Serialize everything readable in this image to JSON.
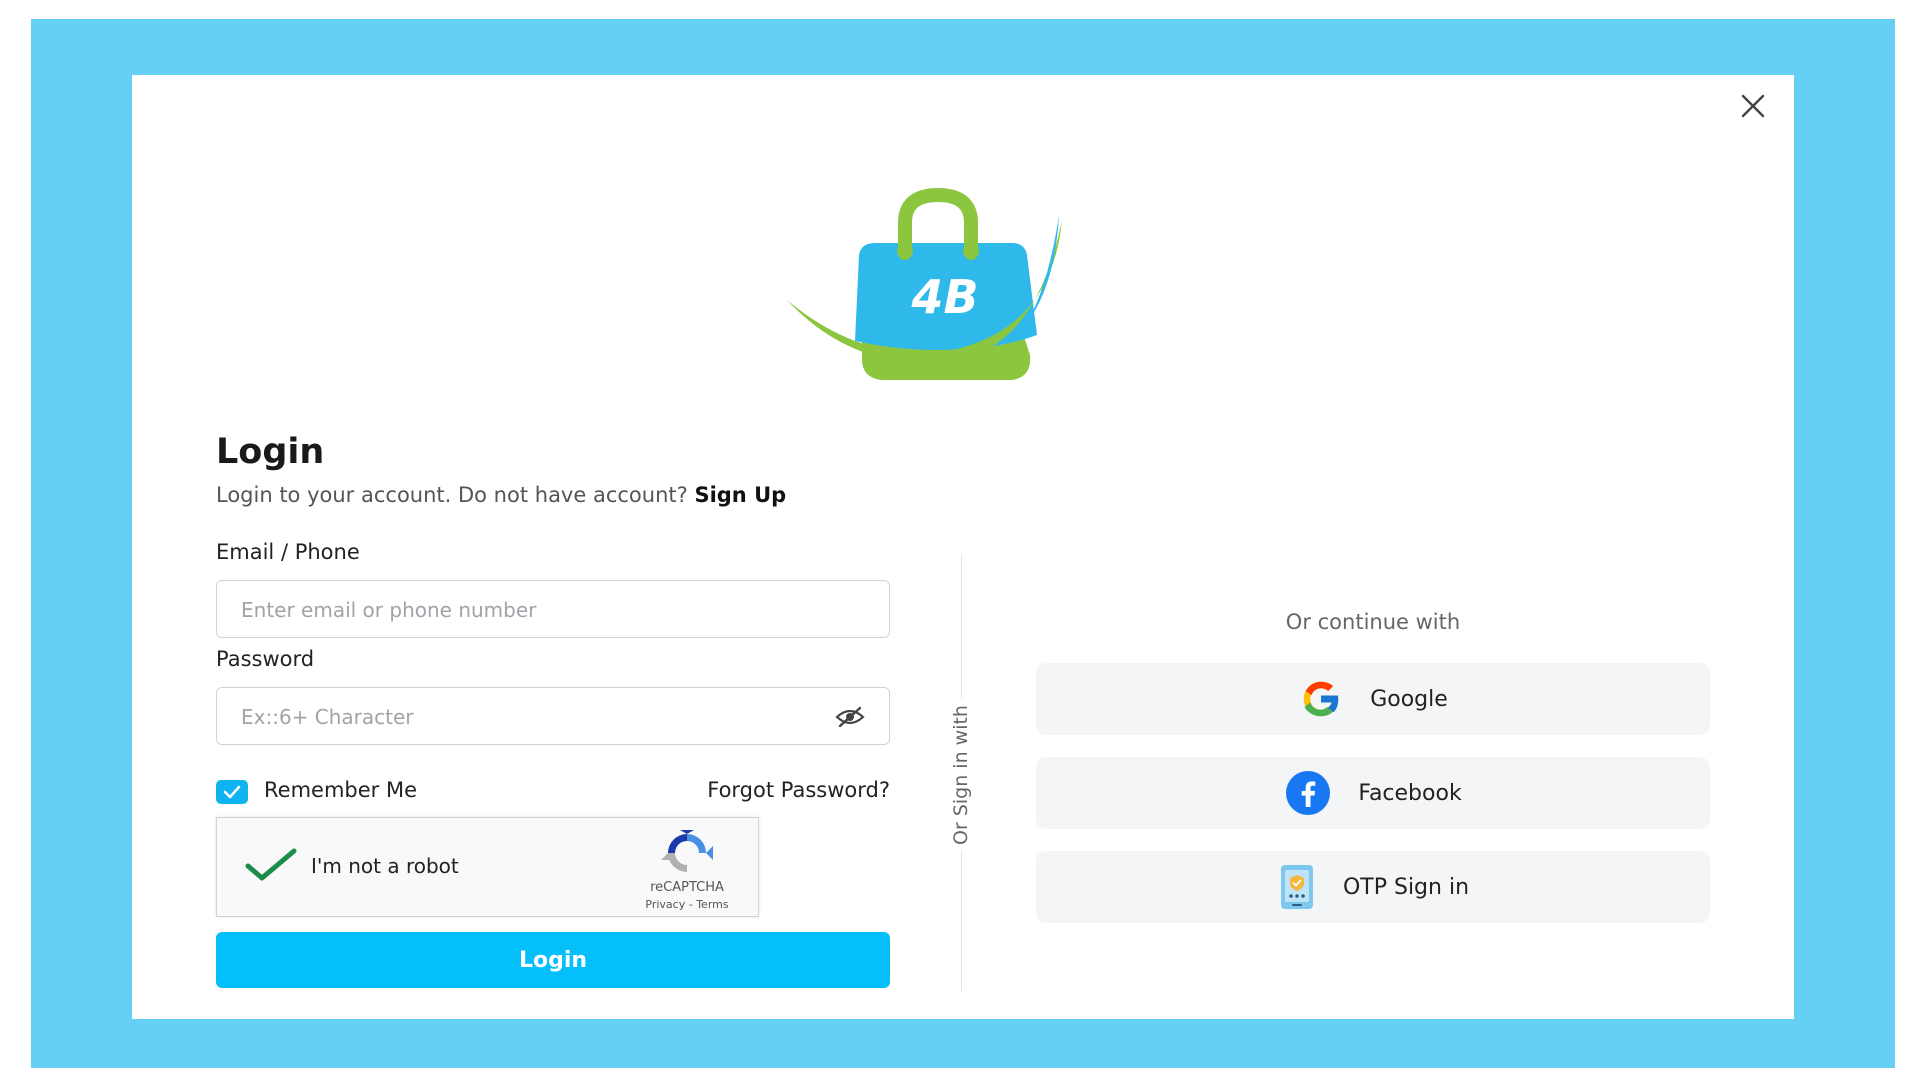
{
  "colors": {
    "backdrop": "#66cff4",
    "primary": "#04bff9",
    "logo_blue": "#2fb9ea",
    "logo_green": "#8cc63f"
  },
  "logo": {
    "text": "4B"
  },
  "login": {
    "title": "Login",
    "subtitle": "Login to your account. Do not have account?",
    "signup_link": "Sign Up",
    "email_label": "Email / Phone",
    "email_placeholder": "Enter email or phone number",
    "email_value": "",
    "password_label": "Password",
    "password_placeholder": "Ex::6+ Character",
    "password_value": "",
    "remember_label": "Remember Me",
    "remember_checked": true,
    "forgot_link": "Forgot Password?",
    "submit_label": "Login"
  },
  "recaptcha": {
    "label": "I'm not a robot",
    "brand": "reCAPTCHA",
    "links": "Privacy - Terms",
    "checked": true
  },
  "divider": {
    "label": "Or Sign in with"
  },
  "social": {
    "heading": "Or continue with",
    "buttons": [
      {
        "label": "Google",
        "icon": "google-icon"
      },
      {
        "label": "Facebook",
        "icon": "facebook-icon"
      },
      {
        "label": "OTP Sign in",
        "icon": "otp-phone-icon"
      }
    ]
  },
  "icons": {
    "close": "close-icon",
    "password_toggle": "eye-slash-icon",
    "remember": "checkbox-check-icon"
  }
}
